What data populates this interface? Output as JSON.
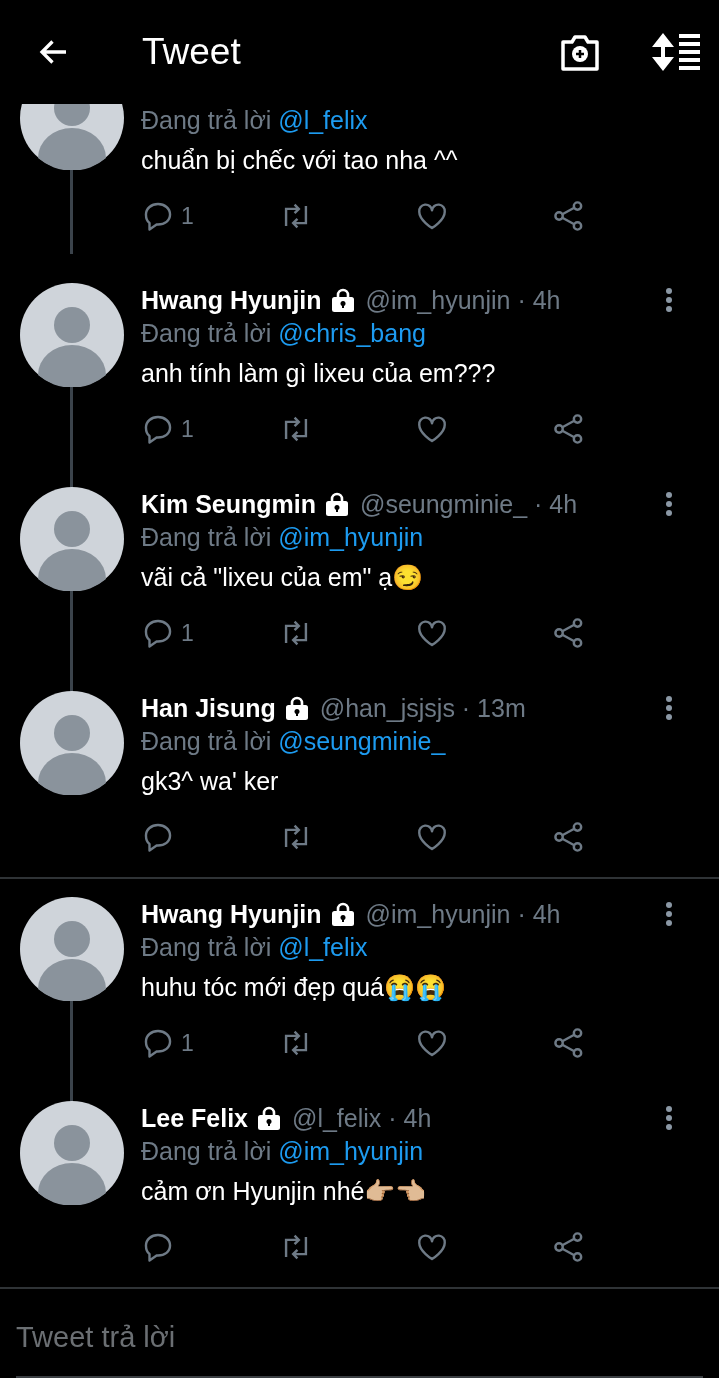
{
  "header": {
    "title": "Tweet"
  },
  "threads": [
    {
      "tweets": [
        {
          "reply_prefix": "Đang trả lời",
          "reply_to": "@l_felix",
          "text": "chuẩn bị chếc với tao nha ^^",
          "reply_count": "1"
        },
        {
          "name": "Hwang Hyunjin",
          "locked": true,
          "meta": "@im_hyunjin · 4h",
          "reply_prefix": "Đang trả lời",
          "reply_to": "@chris_bang",
          "text": "anh tính làm gì lixeu của em???",
          "reply_count": "1"
        },
        {
          "name": "Kim Seungmin",
          "locked": true,
          "meta": "@seungminie_ · 4h",
          "reply_prefix": "Đang trả lời",
          "reply_to": "@im_hyunjin",
          "text": "vãi cả \"lixeu của em\" ạ😏",
          "reply_count": "1"
        },
        {
          "name": "Han Jisung",
          "locked": true,
          "meta": "@han_jsjsjs · 13m",
          "reply_prefix": "Đang trả lời",
          "reply_to": "@seungminie_",
          "text": "gk3^ wa' ker"
        }
      ]
    },
    {
      "tweets": [
        {
          "name": "Hwang Hyunjin",
          "locked": true,
          "meta": "@im_hyunjin · 4h",
          "reply_prefix": "Đang trả lời",
          "reply_to": "@l_felix",
          "text": "huhu tóc mới đẹp quá😭😭",
          "reply_count": "1"
        },
        {
          "name": "Lee Felix",
          "locked": true,
          "meta": "@l_felix · 4h",
          "reply_prefix": "Đang trả lời",
          "reply_to": "@im_hyunjin",
          "text": "cảm ơn Hyunjin nhé👉🏼👈🏼"
        }
      ]
    }
  ],
  "reply_field": {
    "placeholder": "Tweet trả lời"
  }
}
